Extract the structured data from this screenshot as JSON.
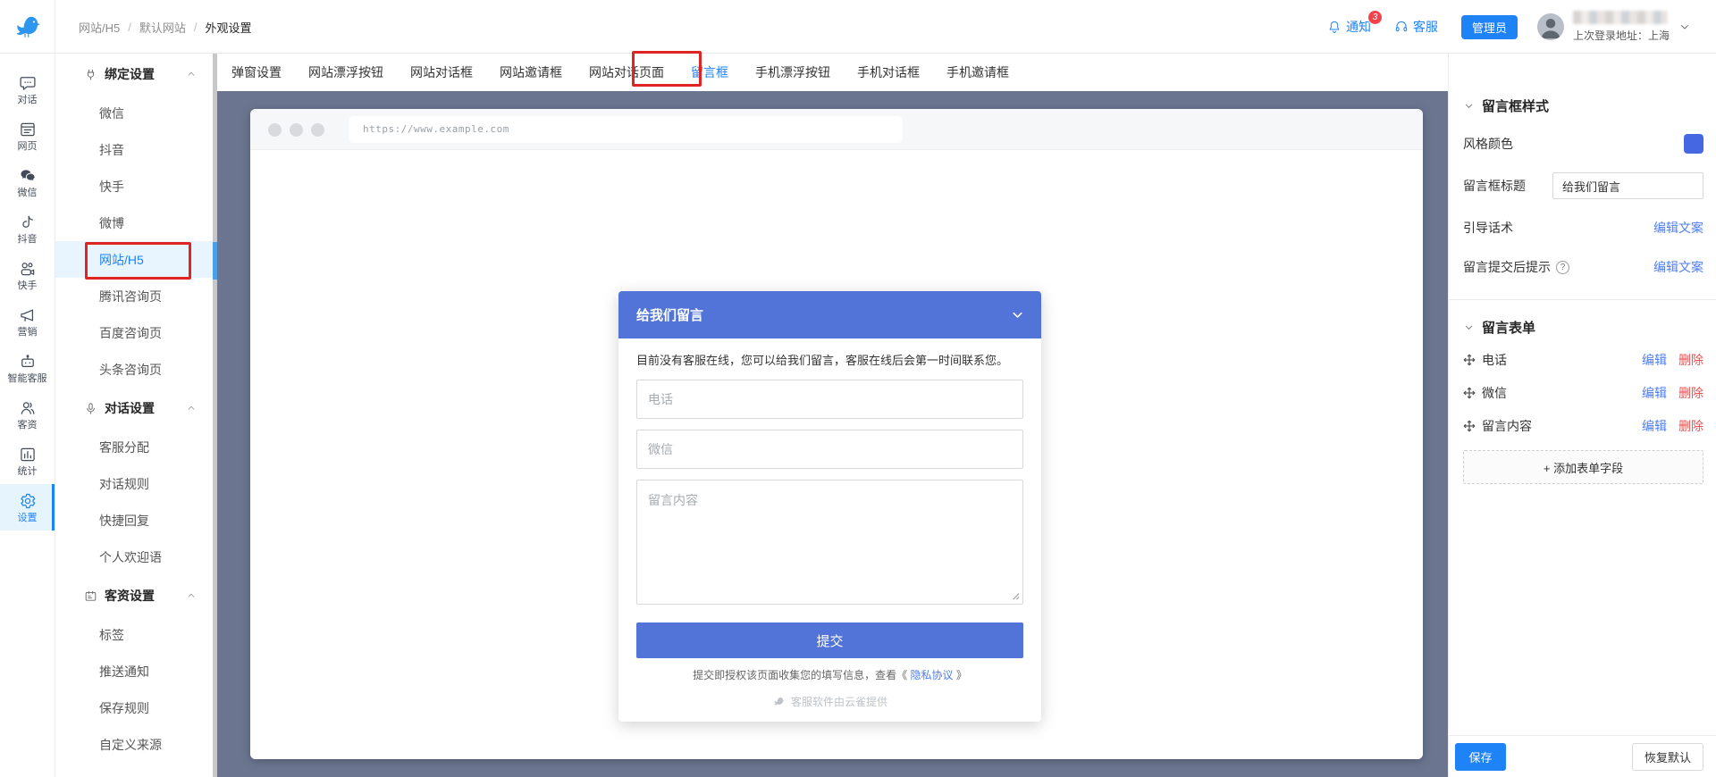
{
  "header": {
    "breadcrumb": {
      "items": [
        "网站/H5",
        "默认网站",
        "外观设置"
      ],
      "separator": "/"
    },
    "notice": {
      "label": "通知",
      "badge": "3"
    },
    "support": {
      "label": "客服"
    },
    "role_badge": "管理员",
    "last_login": "上次登录地址：上海"
  },
  "rail": {
    "items": [
      {
        "label": "对话",
        "icon": "chat-icon"
      },
      {
        "label": "网页",
        "icon": "webpage-icon"
      },
      {
        "label": "微信",
        "icon": "wechat-icon"
      },
      {
        "label": "抖音",
        "icon": "douyin-icon"
      },
      {
        "label": "快手",
        "icon": "kuaishou-icon"
      },
      {
        "label": "营销",
        "icon": "megaphone-icon"
      },
      {
        "label": "智能客服",
        "icon": "robot-icon"
      },
      {
        "label": "客资",
        "icon": "customers-icon"
      },
      {
        "label": "统计",
        "icon": "stats-icon"
      },
      {
        "label": "设置",
        "icon": "gear-icon"
      }
    ],
    "active": "设置"
  },
  "sidebar": {
    "sections": [
      {
        "title": "绑定设置",
        "icon": "plug-icon",
        "items": [
          {
            "label": "微信"
          },
          {
            "label": "抖音"
          },
          {
            "label": "快手"
          },
          {
            "label": "微博"
          },
          {
            "label": "网站/H5",
            "active": true
          },
          {
            "label": "腾讯咨询页"
          },
          {
            "label": "百度咨询页"
          },
          {
            "label": "头条咨询页"
          }
        ]
      },
      {
        "title": "对话设置",
        "icon": "mic-icon",
        "items": [
          {
            "label": "客服分配"
          },
          {
            "label": "对话规则"
          },
          {
            "label": "快捷回复"
          },
          {
            "label": "个人欢迎语"
          }
        ]
      },
      {
        "title": "客资设置",
        "icon": "id-card-icon",
        "items": [
          {
            "label": "标签"
          },
          {
            "label": "推送通知"
          },
          {
            "label": "保存规则"
          },
          {
            "label": "自定义来源"
          }
        ]
      }
    ]
  },
  "tabs": {
    "items": [
      "弹窗设置",
      "网站漂浮按钮",
      "网站对话框",
      "网站邀请框",
      "网站对话页面",
      "留言框",
      "手机漂浮按钮",
      "手机对话框",
      "手机邀请框"
    ],
    "active": "留言框"
  },
  "preview": {
    "url": "https://www.example.com",
    "form": {
      "title": "给我们留言",
      "intro": "目前没有客服在线，您可以给我们留言，客服在线后会第一时间联系您。",
      "placeholders": {
        "phone": "电话",
        "wechat": "微信",
        "message": "留言内容"
      },
      "submit_label": "提交",
      "privacy_prefix": "提交即授权该页面收集您的填写信息，查看《 ",
      "privacy_link": "隐私协议",
      "privacy_suffix": " 》",
      "powered_by": "客服软件由云雀提供"
    }
  },
  "panel": {
    "style_section": {
      "title": "留言框样式",
      "color_label": "风格颜色",
      "title_label": "留言框标题",
      "title_value": "给我们留言",
      "guide_label": "引导话术",
      "after_submit_label": "留言提交后提示",
      "edit_copy_label": "编辑文案"
    },
    "form_section": {
      "title": "留言表单",
      "fields": [
        {
          "label": "电话"
        },
        {
          "label": "微信"
        },
        {
          "label": "留言内容"
        }
      ],
      "edit_label": "编辑",
      "delete_label": "删除",
      "add_button": "+ 添加表单字段"
    },
    "footer": {
      "save": "保存",
      "reset": "恢复默认"
    }
  },
  "colors": {
    "primary": "#1E83F7",
    "theme": "#5273D8",
    "swatch": "#4667E2",
    "danger": "#EF4F4F",
    "canvas": "#6B7590",
    "badge-red": "#F5414B",
    "link": "#4E7DF2",
    "anno": "#E02424"
  }
}
